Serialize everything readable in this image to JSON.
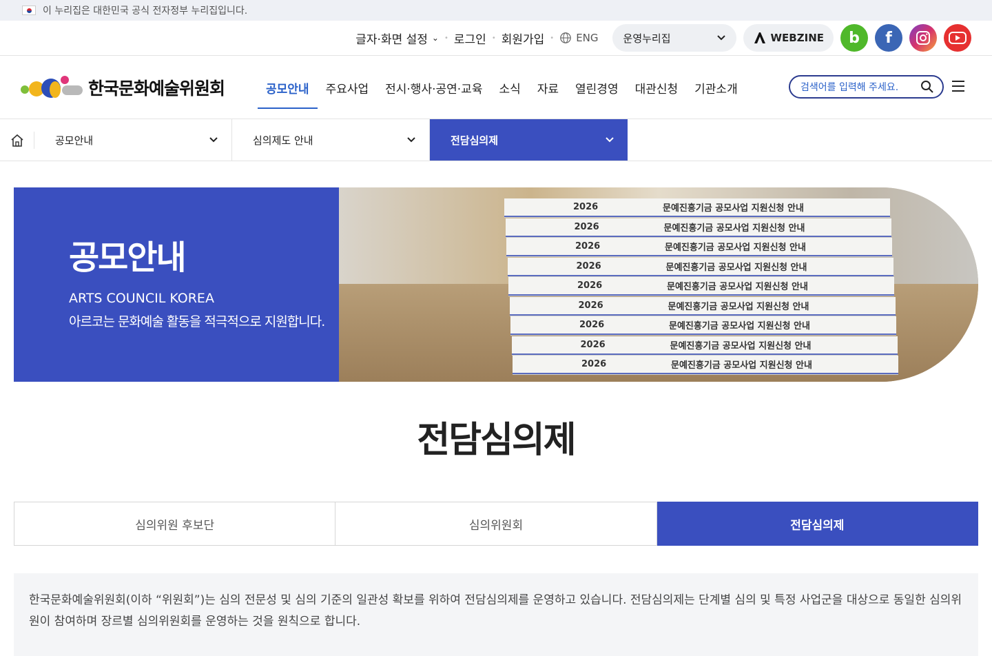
{
  "gov_banner": {
    "text": "이 누리집은 대한민국 공식 전자정부 누리집입니다."
  },
  "util": {
    "font_setting": "글자·화면 설정",
    "login": "로그인",
    "signup": "회원가입",
    "lang": "ENG",
    "site_select": "운영누리집",
    "webzine": "WEBZINE",
    "sns": [
      {
        "name": "blog",
        "glyph": "b",
        "color": "#4fb82a"
      },
      {
        "name": "facebook",
        "glyph": "f",
        "color": "#3b66b5"
      },
      {
        "name": "instagram",
        "glyph": "◎",
        "color": "#c23c8c"
      },
      {
        "name": "youtube",
        "glyph": "▶",
        "color": "#e63030"
      }
    ]
  },
  "header": {
    "logo_text": "한국문화예술위원회",
    "nav": [
      "공모안내",
      "주요사업",
      "전시·행사·공연·교육",
      "소식",
      "자료",
      "열린경영",
      "대관신청",
      "기관소개"
    ],
    "search_placeholder": "검색어를 입력해 주세요."
  },
  "breadcrumb": {
    "items": [
      "공모안내",
      "심의제도 안내",
      "전담심의제"
    ]
  },
  "hero": {
    "title": "공모안내",
    "sub_en": "ARTS COUNCIL KOREA",
    "sub_ko": "아르코는 문화예술 활동을 적극적으로 지원합니다.",
    "book_year": "2026",
    "book_title": "문예진흥기금 공모사업 지원신청 안내"
  },
  "page_title": "전담심의제",
  "tabs": [
    "심의위원 후보단",
    "심의위원회",
    "전담심의제"
  ],
  "info_text": "한국문화예술위원회(이하 “위원회”)는 심의 전문성 및 심의 기준의 일관성 확보를 위하여 전담심의제를 운영하고 있습니다. 전담심의제는 단계별 심의 및 특정 사업군을 대상으로 동일한 심의위원이 참여하며 장르별 심의위원회를 운영하는 것을 원칙으로 합니다.",
  "colors": {
    "primary": "#3a4fbf",
    "link": "#2a61c9"
  }
}
